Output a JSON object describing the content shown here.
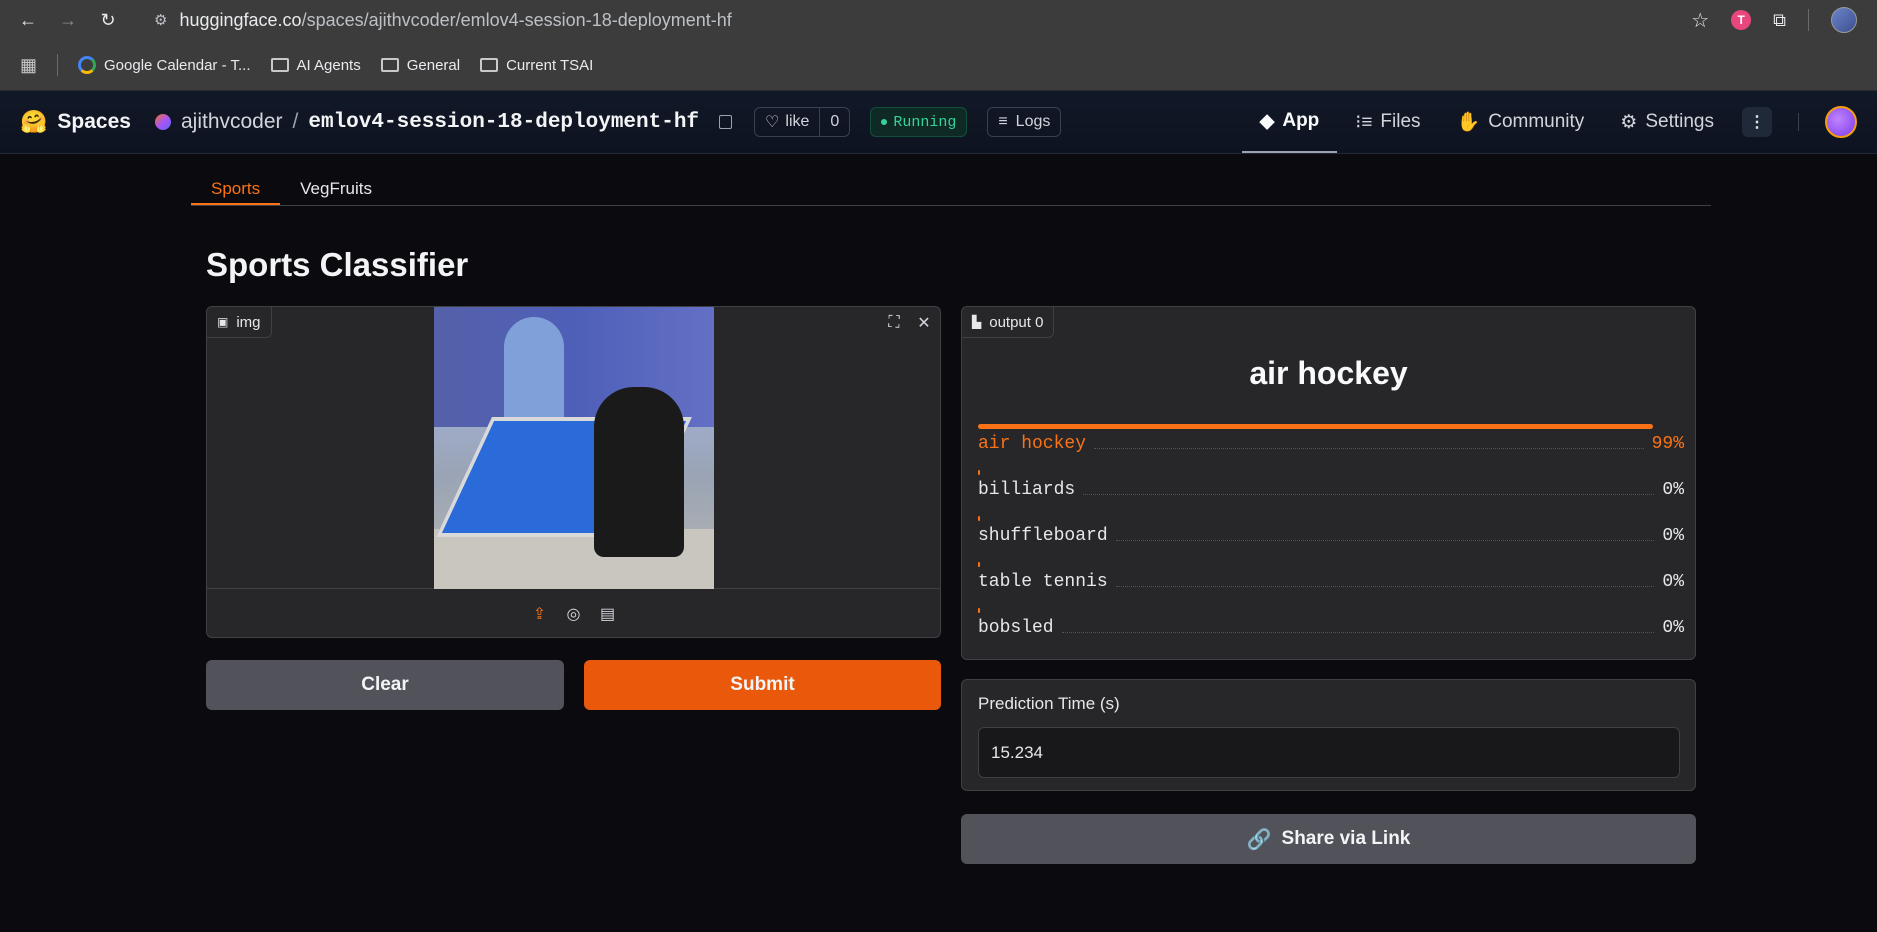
{
  "browser": {
    "url_host": "huggingface.co",
    "url_path": "/spaces/ajithvcoder/emlov4-session-18-deployment-hf",
    "bookmarks": [
      "Google Calendar - T...",
      "AI Agents",
      "General",
      "Current TSAI"
    ],
    "profile_initial": "T"
  },
  "hf": {
    "spaces_label": "Spaces",
    "owner": "ajithvcoder",
    "repo": "emlov4-session-18-deployment-hf",
    "like_label": "like",
    "like_count": "0",
    "status": "Running",
    "logs_label": "Logs",
    "tabs": [
      "App",
      "Files",
      "Community",
      "Settings"
    ]
  },
  "app": {
    "tabs": [
      "Sports",
      "VegFruits"
    ],
    "active_tab": "Sports",
    "title": "Sports Classifier",
    "image_label": "img",
    "output_label": "output 0",
    "prediction": "air hockey",
    "confidences": [
      {
        "label": "air hockey",
        "pct": "99%",
        "value": 0.99
      },
      {
        "label": "billiards",
        "pct": "0%",
        "value": 0.0
      },
      {
        "label": "shuffleboard",
        "pct": "0%",
        "value": 0.0
      },
      {
        "label": "table tennis",
        "pct": "0%",
        "value": 0.0
      },
      {
        "label": "bobsled",
        "pct": "0%",
        "value": 0.0
      }
    ],
    "clear_label": "Clear",
    "submit_label": "Submit",
    "pred_time_label": "Prediction Time (s)",
    "pred_time_value": "15.234",
    "share_label": "Share via Link"
  },
  "colors": {
    "accent": "#f97316",
    "submit": "#ea580c",
    "running": "#34d399"
  }
}
